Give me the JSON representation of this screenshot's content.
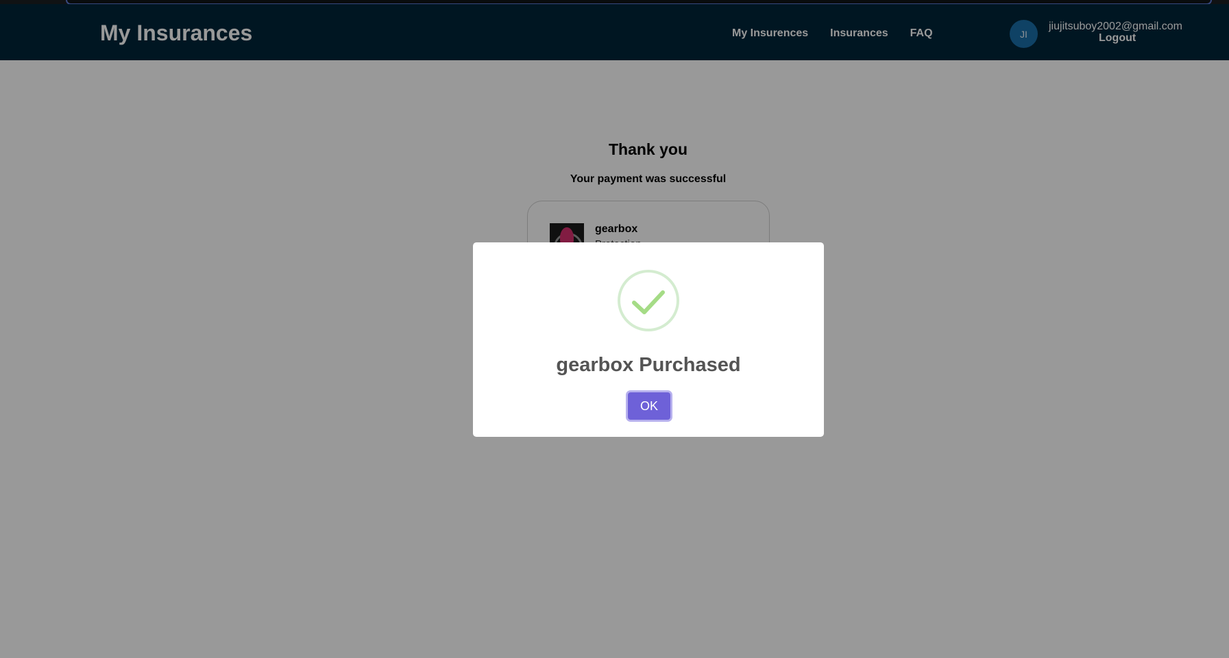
{
  "browser": {},
  "navbar": {
    "brand": "My Insurances",
    "links": [
      "My Insurences",
      "Insurances",
      "FAQ"
    ],
    "avatar_initials": "JI",
    "user_email": "jiujitsuboy2002@gmail.com",
    "logout_label": "Logout"
  },
  "content": {
    "title": "Thank you",
    "subtitle": "Your payment was successful",
    "product_name": "gearbox",
    "product_desc": "Protection"
  },
  "modal": {
    "icon": "check-icon",
    "title": "gearbox Purchased",
    "ok_label": "OK",
    "colors": {
      "button": "#6e61d8",
      "check": "#a5dc86",
      "ring": "#d4ecd0"
    }
  }
}
